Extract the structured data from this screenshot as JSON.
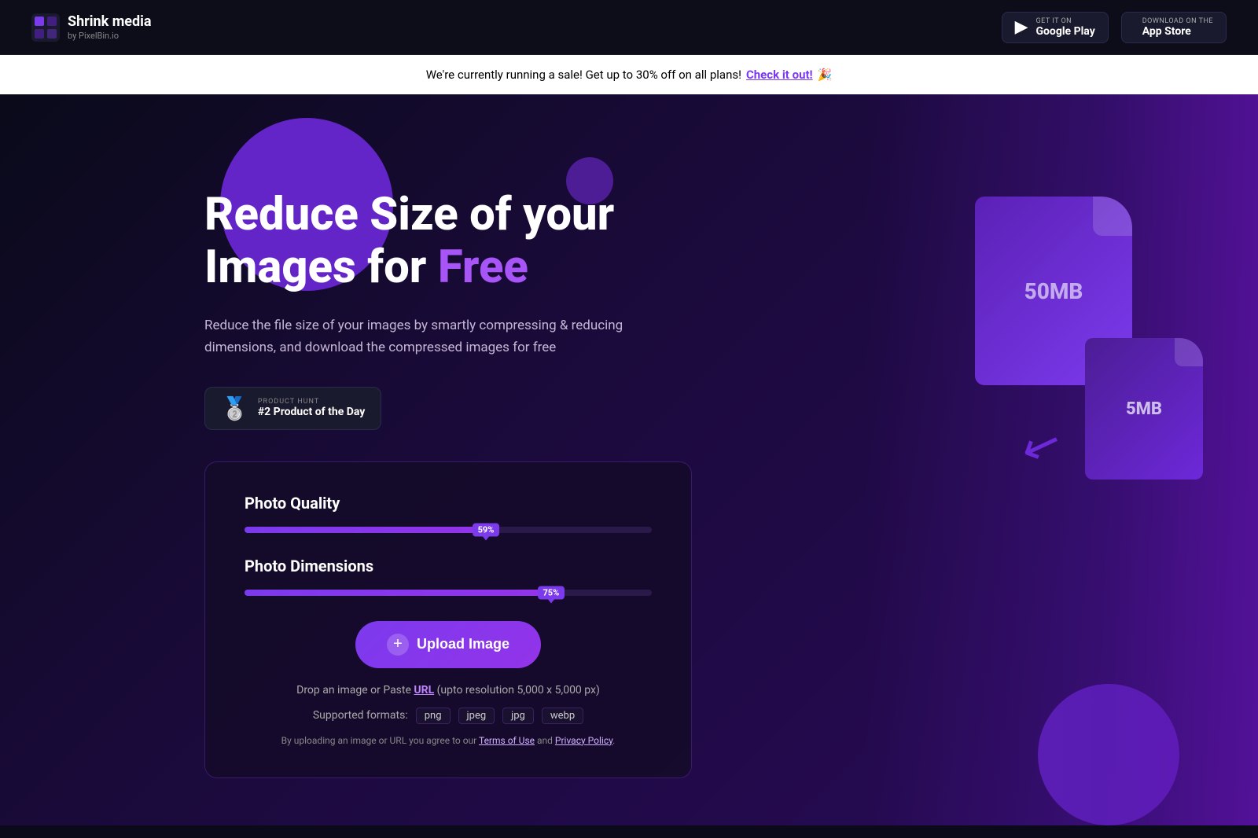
{
  "header": {
    "logo_title": "Shrink media",
    "logo_subtitle": "by PixelBin.io",
    "google_play": {
      "get_on": "GET IT ON",
      "store_name": "Google Play"
    },
    "app_store": {
      "get_on": "Download on the",
      "store_name": "App Store"
    }
  },
  "promo": {
    "text": "We're currently running a sale! Get up to 30% off on all plans!",
    "link_text": "Check it out!",
    "emoji": "🎉"
  },
  "hero": {
    "title_line1": "Reduce Size of your",
    "title_line2_prefix": "Images for ",
    "title_line2_accent": "Free",
    "subtitle": "Reduce the file size of your images by smartly compressing & reducing dimensions, and download the compressed images for free",
    "product_hunt_label": "PRODUCT HUNT",
    "product_hunt_text": "#2 Product of the Day"
  },
  "upload_card": {
    "quality_label": "Photo Quality",
    "quality_value": "59%",
    "quality_percent": 59,
    "dimensions_label": "Photo Dimensions",
    "dimensions_value": "75%",
    "dimensions_percent": 75,
    "upload_button": "Upload Image",
    "drop_text_prefix": "Drop an image or Paste ",
    "drop_url": "URL",
    "drop_text_suffix": " (upto resolution 5,000 x 5,000 px)",
    "formats_label": "Supported formats:",
    "formats": [
      "png",
      "jpeg",
      "jpg",
      "webp"
    ],
    "terms_prefix": "By uploading an image or URL you agree to our ",
    "terms_link": "Terms of Use",
    "terms_middle": " and ",
    "privacy_link": "Privacy Policy",
    "terms_suffix": "."
  },
  "file_icons": {
    "large_label": "50MB",
    "small_label": "5MB"
  },
  "icons": {
    "google_play_icon": "▶",
    "apple_icon": "",
    "plus_icon": "+",
    "ph_emoji": "🥈"
  }
}
